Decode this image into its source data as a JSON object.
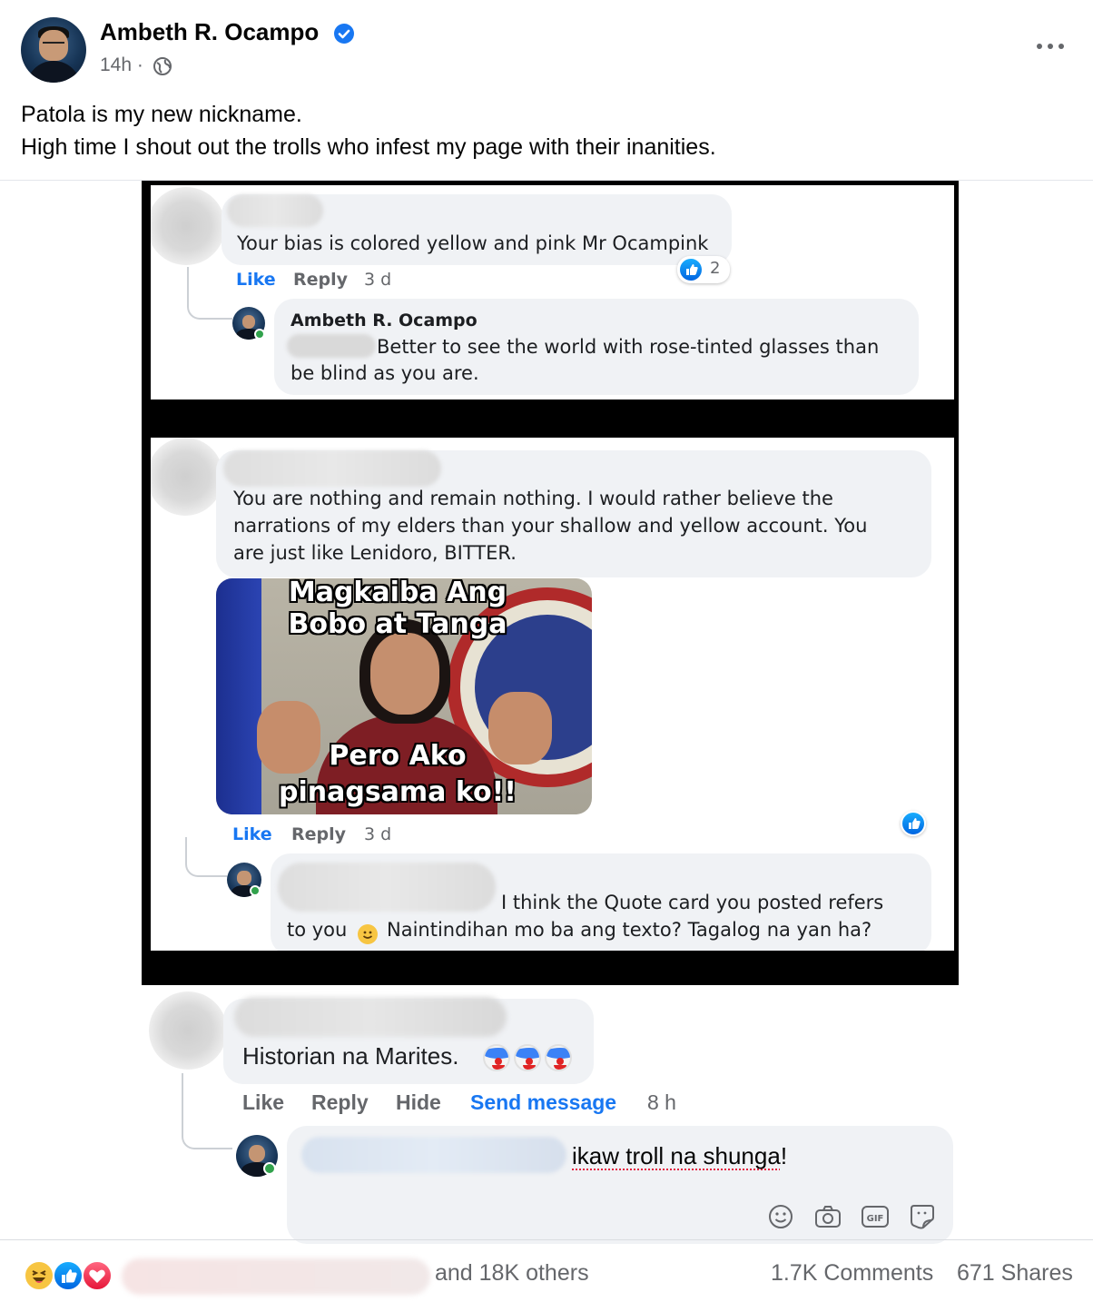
{
  "post": {
    "author": "Ambeth R. Ocampo",
    "time": "14h ·",
    "caption_line1": "Patola is my new nickname.",
    "caption_line2": "High time I shout out the trolls who infest my page with their inanities."
  },
  "screenshot": {
    "comment1": {
      "text": "Your bias is colored yellow and pink Mr Ocampink",
      "like": "Like",
      "reply": "Reply",
      "time": "3 d",
      "reactions": "2"
    },
    "reply1": {
      "name": "Ambeth R. Ocampo",
      "text_line1": "Better to see the world with rose-tinted glasses than",
      "text_line2": "be blind as you are."
    },
    "comment2": {
      "line1": "You are nothing and remain nothing. I would rather believe the",
      "line2": "narrations of my elders than your shallow and yellow account. You",
      "line3": "are just like Lenidoro, BITTER.",
      "meme_top1": "Magkaiba Ang",
      "meme_top2": "Bobo at Tanga",
      "meme_bottom1": "Pero Ako",
      "meme_bottom2": "pinagsama ko!!",
      "like": "Like",
      "reply": "Reply",
      "time": "3 d"
    },
    "reply2": {
      "text_line1": "I think the Quote card you posted refers",
      "text_line2a": "to you",
      "text_line2b": "Naintindihan mo ba ang texto? Tagalog na yan ha?"
    }
  },
  "comment3": {
    "text": "Historian na Marites.",
    "like": "Like",
    "reply": "Reply",
    "hide": "Hide",
    "send_message": "Send message",
    "time": "8 h"
  },
  "reply_draft": {
    "text_a": "ikaw troll na ",
    "text_b": "shunga",
    "text_c": "!"
  },
  "footer": {
    "others": "and 18K others",
    "comments": "1.7K Comments",
    "shares": "671 Shares"
  },
  "colors": {
    "facebook_blue": "#1877f2",
    "secondary_text": "#65676b",
    "bubble_bg": "#f0f2f5"
  }
}
